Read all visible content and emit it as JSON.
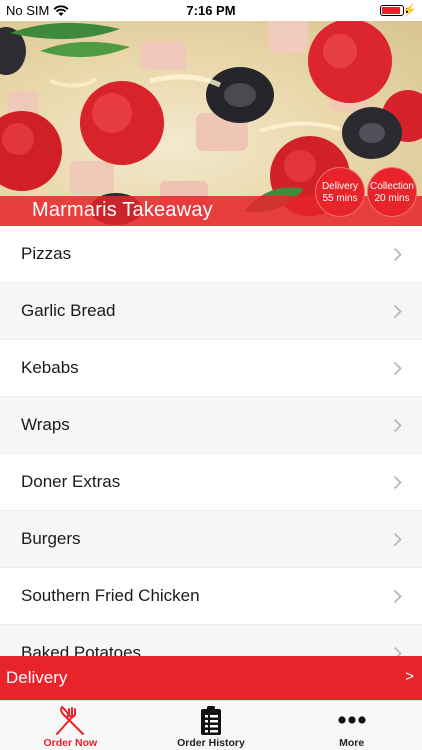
{
  "status_bar": {
    "carrier": "No SIM",
    "time": "7:16 PM",
    "battery_level": 0.9,
    "icons": [
      "wifi-icon",
      "battery-icon",
      "charging-bolt-icon"
    ]
  },
  "hero": {
    "title": "Marmaris Takeaway",
    "delivery_badge": {
      "line1": "Delivery",
      "line2": "55 mins"
    },
    "collection_badge": {
      "line1": "Collection",
      "line2": "20 mins"
    }
  },
  "menu": {
    "items": [
      {
        "label": "Pizzas"
      },
      {
        "label": "Garlic Bread"
      },
      {
        "label": "Kebabs"
      },
      {
        "label": "Wraps"
      },
      {
        "label": "Doner Extras"
      },
      {
        "label": "Burgers"
      },
      {
        "label": "Southern Fried Chicken"
      },
      {
        "label": "Baked Potatoes"
      }
    ]
  },
  "delivery_bar": {
    "label": "Delivery",
    "arrow": ">"
  },
  "tab_bar": {
    "tabs": [
      {
        "label": "Order Now",
        "icon": "fork-knife-icon",
        "active": true
      },
      {
        "label": "Order History",
        "icon": "clipboard-list-icon",
        "active": false
      },
      {
        "label": "More",
        "icon": "more-dots-icon",
        "active": false
      }
    ]
  },
  "colors": {
    "accent": "#e8232a",
    "tab_bar_bg": "#f7f7f7"
  }
}
